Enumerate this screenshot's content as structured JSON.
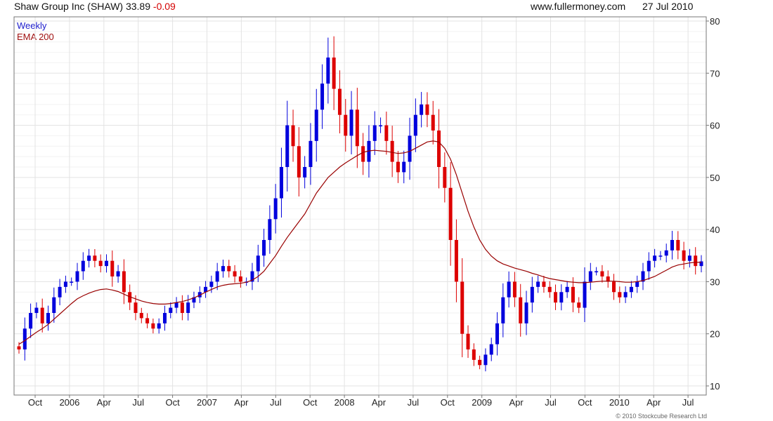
{
  "header": {
    "title": "Shaw Group Inc (SHAW) 33.89",
    "change": "-0.09",
    "website": "www.fullermoney.com",
    "date": "27 Jul 2010"
  },
  "legend": {
    "weekly": "Weekly",
    "ema": "EMA 200"
  },
  "copyright": "© 2010 Stockcube Research Ltd",
  "colors": {
    "up": "#0000dd",
    "down": "#dd0000",
    "ema": "#990000",
    "grid": "#e3e3e3",
    "frame": "#777777"
  },
  "chart_data": {
    "type": "line",
    "ylim": [
      10,
      80
    ],
    "yticks": [
      10,
      20,
      30,
      40,
      50,
      60,
      70,
      80
    ],
    "xticks": [
      "Oct",
      "2006",
      "Apr",
      "Jul",
      "Oct",
      "2007",
      "Apr",
      "Jul",
      "Oct",
      "2008",
      "Apr",
      "Jul",
      "Oct",
      "2009",
      "Apr",
      "Jul",
      "Oct",
      "2010",
      "Apr",
      "Jul"
    ],
    "grid": true,
    "series": [
      {
        "name": "Weekly",
        "close": [
          17,
          21,
          24,
          25,
          22,
          24,
          27,
          29,
          30,
          30,
          32,
          34,
          35,
          34,
          33,
          34,
          31,
          32,
          28,
          26,
          24,
          23,
          22,
          21,
          22,
          24,
          25,
          26,
          24,
          26,
          27,
          28,
          29,
          30,
          32,
          33,
          32,
          31,
          30,
          30,
          32,
          35,
          38,
          42,
          46,
          52,
          60,
          56,
          50,
          52,
          57,
          63,
          68,
          73,
          67,
          62,
          58,
          63,
          56,
          53,
          57,
          60,
          60,
          57,
          53,
          51,
          53,
          58,
          62,
          64,
          62,
          59,
          52,
          48,
          38,
          30,
          20,
          17,
          15,
          14,
          16,
          18,
          22,
          27,
          30,
          27,
          22,
          26,
          29,
          30,
          29,
          28,
          26,
          28,
          29,
          26,
          25,
          30,
          32,
          32,
          31,
          30,
          28,
          27,
          28,
          29,
          30,
          32,
          34,
          35,
          35,
          36,
          38,
          36,
          34,
          35,
          33,
          33.89
        ]
      },
      {
        "name": "EMA 200",
        "values": [
          18,
          18.7,
          19.5,
          20.3,
          21,
          21.8,
          22.8,
          23.8,
          24.8,
          25.8,
          26.7,
          27.3,
          27.8,
          28.2,
          28.5,
          28.6,
          28.4,
          28.1,
          27.6,
          27.1,
          26.7,
          26.3,
          26,
          25.8,
          25.7,
          25.7,
          25.8,
          26,
          26.2,
          26.5,
          26.9,
          27.4,
          28,
          28.5,
          29,
          29.3,
          29.5,
          29.6,
          29.7,
          29.9,
          30.3,
          31,
          32,
          33.5,
          35,
          36.8,
          38.5,
          40,
          41.5,
          43,
          45,
          47,
          48.5,
          50,
          51,
          52,
          52.8,
          53.5,
          54.2,
          54.8,
          55.1,
          55.2,
          55.1,
          55,
          54.8,
          54.6,
          54.7,
          55,
          55.6,
          56.2,
          56.8,
          57,
          56.8,
          55.6,
          53.5,
          50.5,
          47,
          43.5,
          40.5,
          38,
          36.2,
          34.9,
          34,
          33.4,
          33,
          32.6,
          32.3,
          32,
          31.6,
          31.3,
          30.9,
          30.6,
          30.4,
          30.2,
          30,
          29.9,
          29.8,
          29.8,
          29.9,
          30,
          30.1,
          30.1,
          30.1,
          30,
          29.9,
          29.9,
          30,
          30.2,
          30.6,
          31,
          31.6,
          32.2,
          32.8,
          33.2,
          33.4,
          33.6,
          33.7,
          33.7
        ]
      }
    ]
  }
}
